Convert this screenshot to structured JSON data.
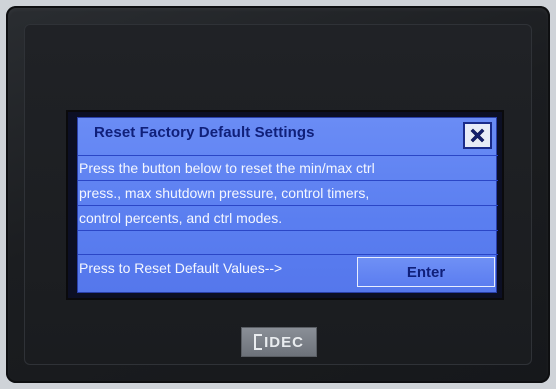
{
  "dialog": {
    "title": "Reset Factory Default Settings",
    "lines": [
      "Press the button below to reset the min/max ctrl",
      "press., max shutdown pressure, control timers,",
      "control percents, and ctrl modes."
    ],
    "reset_label": "Press to Reset Default Values-->",
    "enter_label": "Enter",
    "close_icon": "close-x-icon"
  },
  "device": {
    "logo": "IDEC"
  },
  "colors": {
    "dialog_bg": "#5a7ef0",
    "title_text": "#10207a",
    "body_text": "#f4f7ff",
    "bezel": "#1b1d20"
  }
}
